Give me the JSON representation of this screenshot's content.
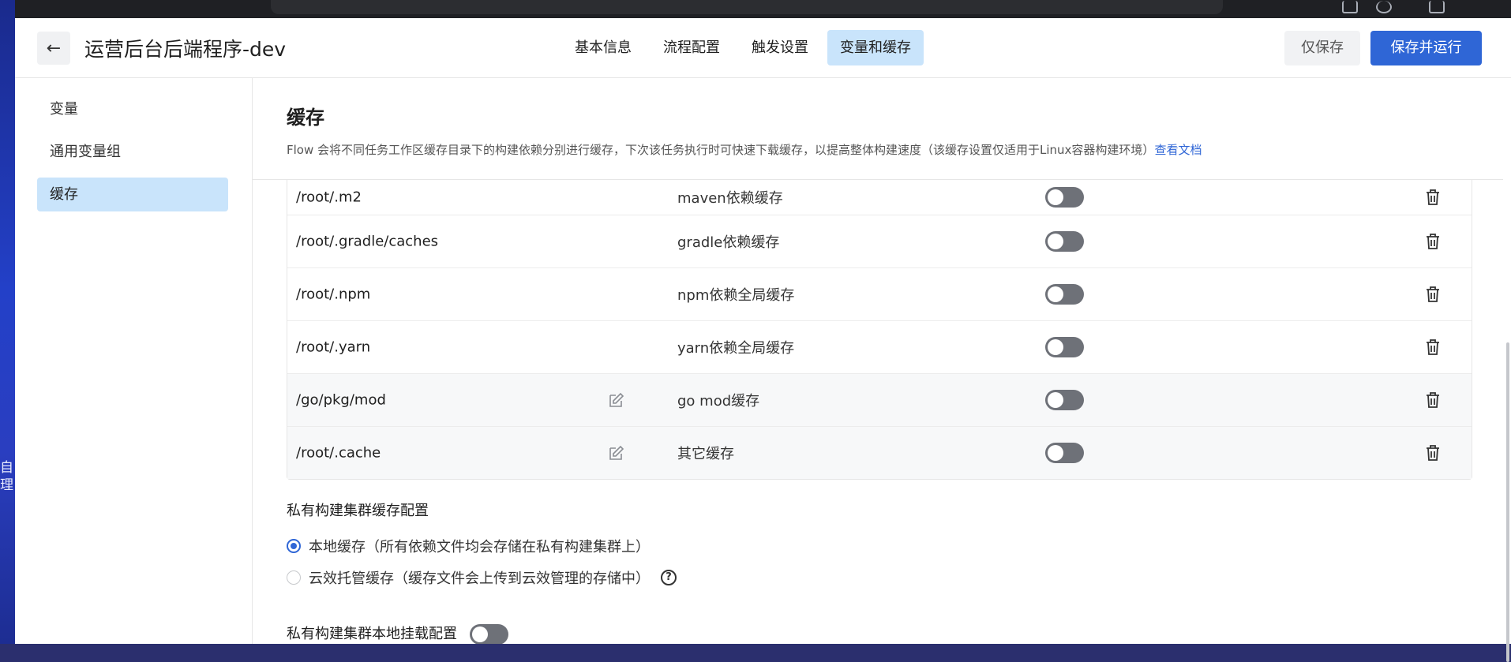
{
  "header": {
    "title": "运营后台后端程序-dev",
    "tabs": [
      {
        "label": "基本信息",
        "active": false
      },
      {
        "label": "流程配置",
        "active": false
      },
      {
        "label": "触发设置",
        "active": false
      },
      {
        "label": "变量和缓存",
        "active": true
      }
    ],
    "save_only_label": "仅保存",
    "save_run_label": "保存并运行"
  },
  "sidebar": {
    "items": [
      {
        "label": "变量",
        "active": false
      },
      {
        "label": "通用变量组",
        "active": false
      },
      {
        "label": "缓存",
        "active": true
      }
    ]
  },
  "cache": {
    "title": "缓存",
    "description": "Flow 会将不同任务工作区缓存目录下的构建依赖分别进行缓存，下次该任务执行时可快速下载缓存，以提高整体构建速度（该缓存设置仅适用于Linux容器构建环境）",
    "doc_link": "查看文档",
    "rows": [
      {
        "path": "/root/.m2",
        "desc": "maven依赖缓存",
        "enabled": false
      },
      {
        "path": "/root/.gradle/caches",
        "desc": "gradle依赖缓存",
        "enabled": false
      },
      {
        "path": "/root/.npm",
        "desc": "npm依赖全局缓存",
        "enabled": false
      },
      {
        "path": "/root/.yarn",
        "desc": "yarn依赖全局缓存",
        "enabled": false
      },
      {
        "path": "/go/pkg/mod",
        "desc": "go mod缓存",
        "enabled": false
      },
      {
        "path": "/root/.cache",
        "desc": "其它缓存",
        "enabled": false
      }
    ]
  },
  "private_cluster": {
    "cache_title": "私有构建集群缓存配置",
    "options": [
      {
        "label": "本地缓存（所有依赖文件均会存储在私有构建集群上）",
        "selected": true
      },
      {
        "label": "云效托管缓存（缓存文件会上传到云效管理的存储中）",
        "selected": false
      }
    ],
    "mount_title": "私有构建集群本地挂载配置",
    "mount_enabled": false
  },
  "desktop": {
    "glyphs": [
      "自",
      "理"
    ]
  },
  "colors": {
    "primary": "#2f66d6",
    "active_tab_bg": "#c9e4fb",
    "toggle_off": "#6e7178"
  }
}
